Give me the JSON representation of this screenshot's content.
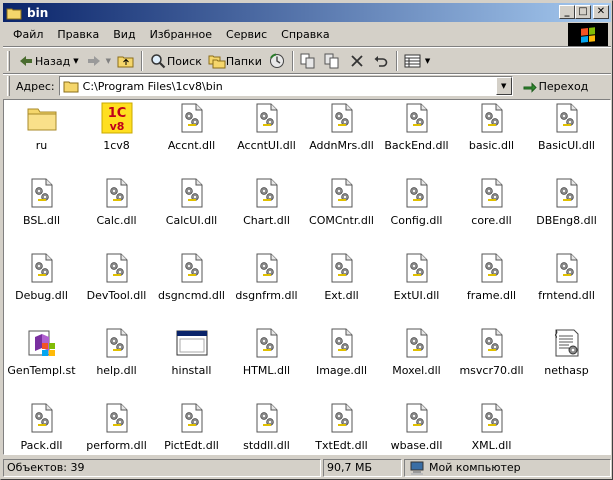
{
  "window": {
    "title": "bin"
  },
  "menu": [
    "Файл",
    "Правка",
    "Вид",
    "Избранное",
    "Сервис",
    "Справка"
  ],
  "toolbar": {
    "back_label": "Назад",
    "search_label": "Поиск",
    "folders_label": "Папки"
  },
  "address": {
    "label": "Адрес:",
    "value": "C:\\Program Files\\1cv8\\bin",
    "go_label": "Переход"
  },
  "files": [
    {
      "name": "ru",
      "type": "folder"
    },
    {
      "name": "1cv8",
      "type": "app-1c"
    },
    {
      "name": "Accnt.dll",
      "type": "dll"
    },
    {
      "name": "AccntUI.dll",
      "type": "dll"
    },
    {
      "name": "AddnMrs.dll",
      "type": "dll"
    },
    {
      "name": "BackEnd.dll",
      "type": "dll"
    },
    {
      "name": "basic.dll",
      "type": "dll"
    },
    {
      "name": "BasicUI.dll",
      "type": "dll"
    },
    {
      "name": "BSL.dll",
      "type": "dll"
    },
    {
      "name": "Calc.dll",
      "type": "dll"
    },
    {
      "name": "CalcUI.dll",
      "type": "dll"
    },
    {
      "name": "Chart.dll",
      "type": "dll"
    },
    {
      "name": "COMCntr.dll",
      "type": "dll"
    },
    {
      "name": "Config.dll",
      "type": "dll"
    },
    {
      "name": "core.dll",
      "type": "dll"
    },
    {
      "name": "DBEng8.dll",
      "type": "dll"
    },
    {
      "name": "Debug.dll",
      "type": "dll"
    },
    {
      "name": "DevTool.dll",
      "type": "dll"
    },
    {
      "name": "dsgncmd.dll",
      "type": "dll"
    },
    {
      "name": "dsgnfrm.dll",
      "type": "dll"
    },
    {
      "name": "Ext.dll",
      "type": "dll"
    },
    {
      "name": "ExtUI.dll",
      "type": "dll"
    },
    {
      "name": "frame.dll",
      "type": "dll"
    },
    {
      "name": "frntend.dll",
      "type": "dll"
    },
    {
      "name": "GenTempl.st",
      "type": "installer"
    },
    {
      "name": "help.dll",
      "type": "dll"
    },
    {
      "name": "hinstall",
      "type": "window-app"
    },
    {
      "name": "HTML.dll",
      "type": "dll"
    },
    {
      "name": "Image.dll",
      "type": "dll"
    },
    {
      "name": "Moxel.dll",
      "type": "dll"
    },
    {
      "name": "msvcr70.dll",
      "type": "dll"
    },
    {
      "name": "nethasp",
      "type": "config"
    },
    {
      "name": "Pack.dll",
      "type": "dll"
    },
    {
      "name": "perform.dll",
      "type": "dll"
    },
    {
      "name": "PictEdt.dll",
      "type": "dll"
    },
    {
      "name": "stddll.dll",
      "type": "dll"
    },
    {
      "name": "TxtEdt.dll",
      "type": "dll"
    },
    {
      "name": "wbase.dll",
      "type": "dll"
    },
    {
      "name": "XML.dll",
      "type": "dll"
    }
  ],
  "status": {
    "objects": "Объектов: 39",
    "size": "90,7 МБ",
    "location": "Мой компьютер"
  },
  "colors": {
    "titlebar_start": "#0a246a",
    "titlebar_end": "#a6caf0",
    "face": "#d4d0c8",
    "content_bg": "#ffffff"
  }
}
